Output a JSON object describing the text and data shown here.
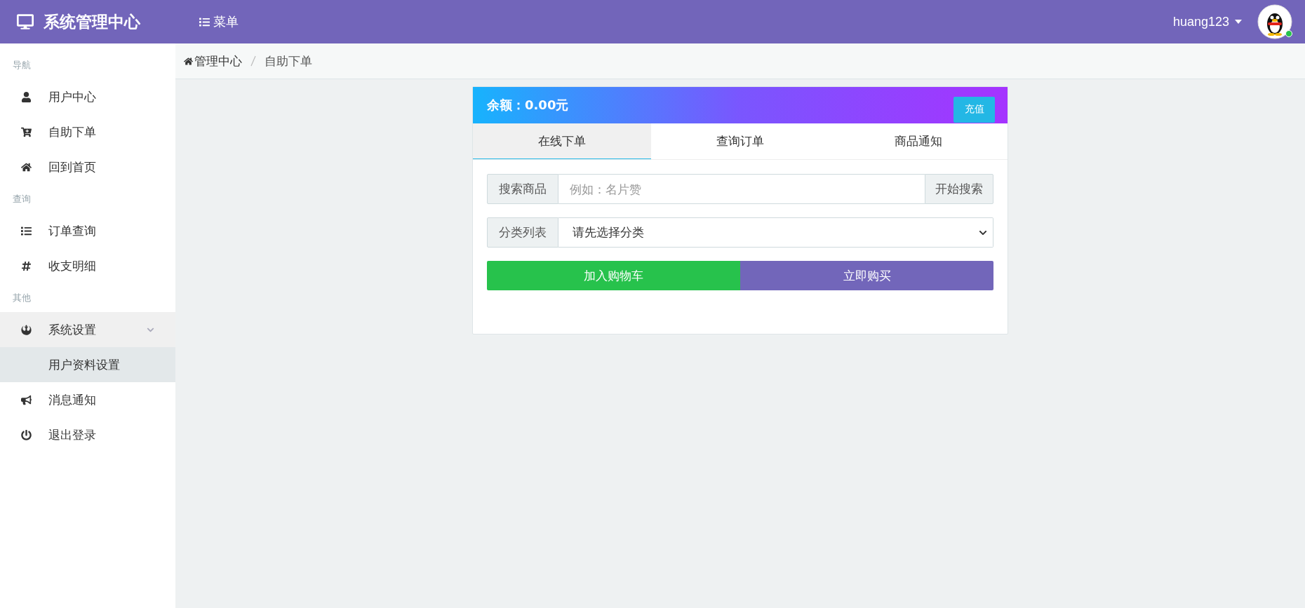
{
  "header": {
    "title": "系统管理中心",
    "menu_label": "菜单",
    "user": {
      "name": "huang123",
      "online": true
    }
  },
  "sidebar": {
    "sections": [
      {
        "label": "导航",
        "items": [
          {
            "label": "用户中心",
            "selected": false
          },
          {
            "label": "自助下单",
            "selected": false
          },
          {
            "label": "回到首页",
            "selected": false
          }
        ]
      },
      {
        "label": "查询",
        "items": [
          {
            "label": "订单查询",
            "selected": false
          },
          {
            "label": "收支明细",
            "selected": false
          }
        ]
      },
      {
        "label": "其他",
        "items": [
          {
            "label": "系统设置",
            "selected": false,
            "expanded": true,
            "children": [
              {
                "label": "用户资料设置",
                "selected": true
              }
            ]
          },
          {
            "label": "消息通知",
            "selected": false
          },
          {
            "label": "退出登录",
            "selected": false
          }
        ]
      }
    ]
  },
  "breadcrumb": [
    "管理中心",
    "自助下单"
  ],
  "panel": {
    "balance": "余额：0.00元",
    "recharge": "充值",
    "tabs": [
      {
        "label": "在线下单",
        "selected": true
      },
      {
        "label": "查询订单",
        "selected": false
      },
      {
        "label": "商品通知",
        "selected": false
      }
    ],
    "search": {
      "addon": "搜索商品",
      "placeholder": "例如：名片赞",
      "button": "开始搜索"
    },
    "category": {
      "addon": "分类列表",
      "value": "请先选择分类"
    },
    "actions": [
      {
        "label": "加入购物车",
        "kind": "cart"
      },
      {
        "label": "立即购买",
        "kind": "buy"
      }
    ]
  }
}
